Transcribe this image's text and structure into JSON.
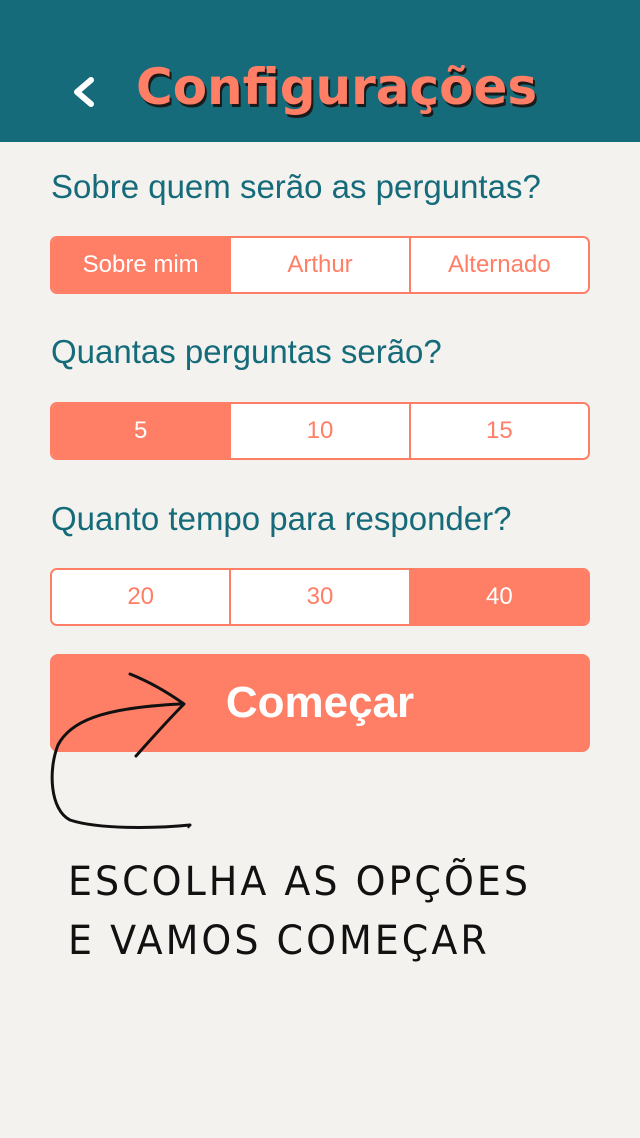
{
  "header": {
    "title": "Configurações",
    "back_icon": "chevron-left-icon"
  },
  "colors": {
    "header_bg": "#166b7a",
    "accent": "#ff7e66",
    "background": "#f3f2ee",
    "question_text": "#166b7a"
  },
  "questions": {
    "about": {
      "label": "Sobre quem serão as perguntas?",
      "options": [
        "Sobre mim",
        "Arthur",
        "Alternado"
      ],
      "selected": "Sobre mim"
    },
    "count": {
      "label": "Quantas perguntas serão?",
      "options": [
        "5",
        "10",
        "15"
      ],
      "selected": "5"
    },
    "time": {
      "label": "Quanto tempo para responder?",
      "options": [
        "20",
        "30",
        "40"
      ],
      "selected": "40"
    }
  },
  "start_button": {
    "label": "Começar"
  },
  "hint": {
    "line1": "ESCOLHA AS OPÇÕES",
    "line2": "E VAMOS COMEÇAR",
    "icon": "hand-drawn-arrow-icon"
  }
}
